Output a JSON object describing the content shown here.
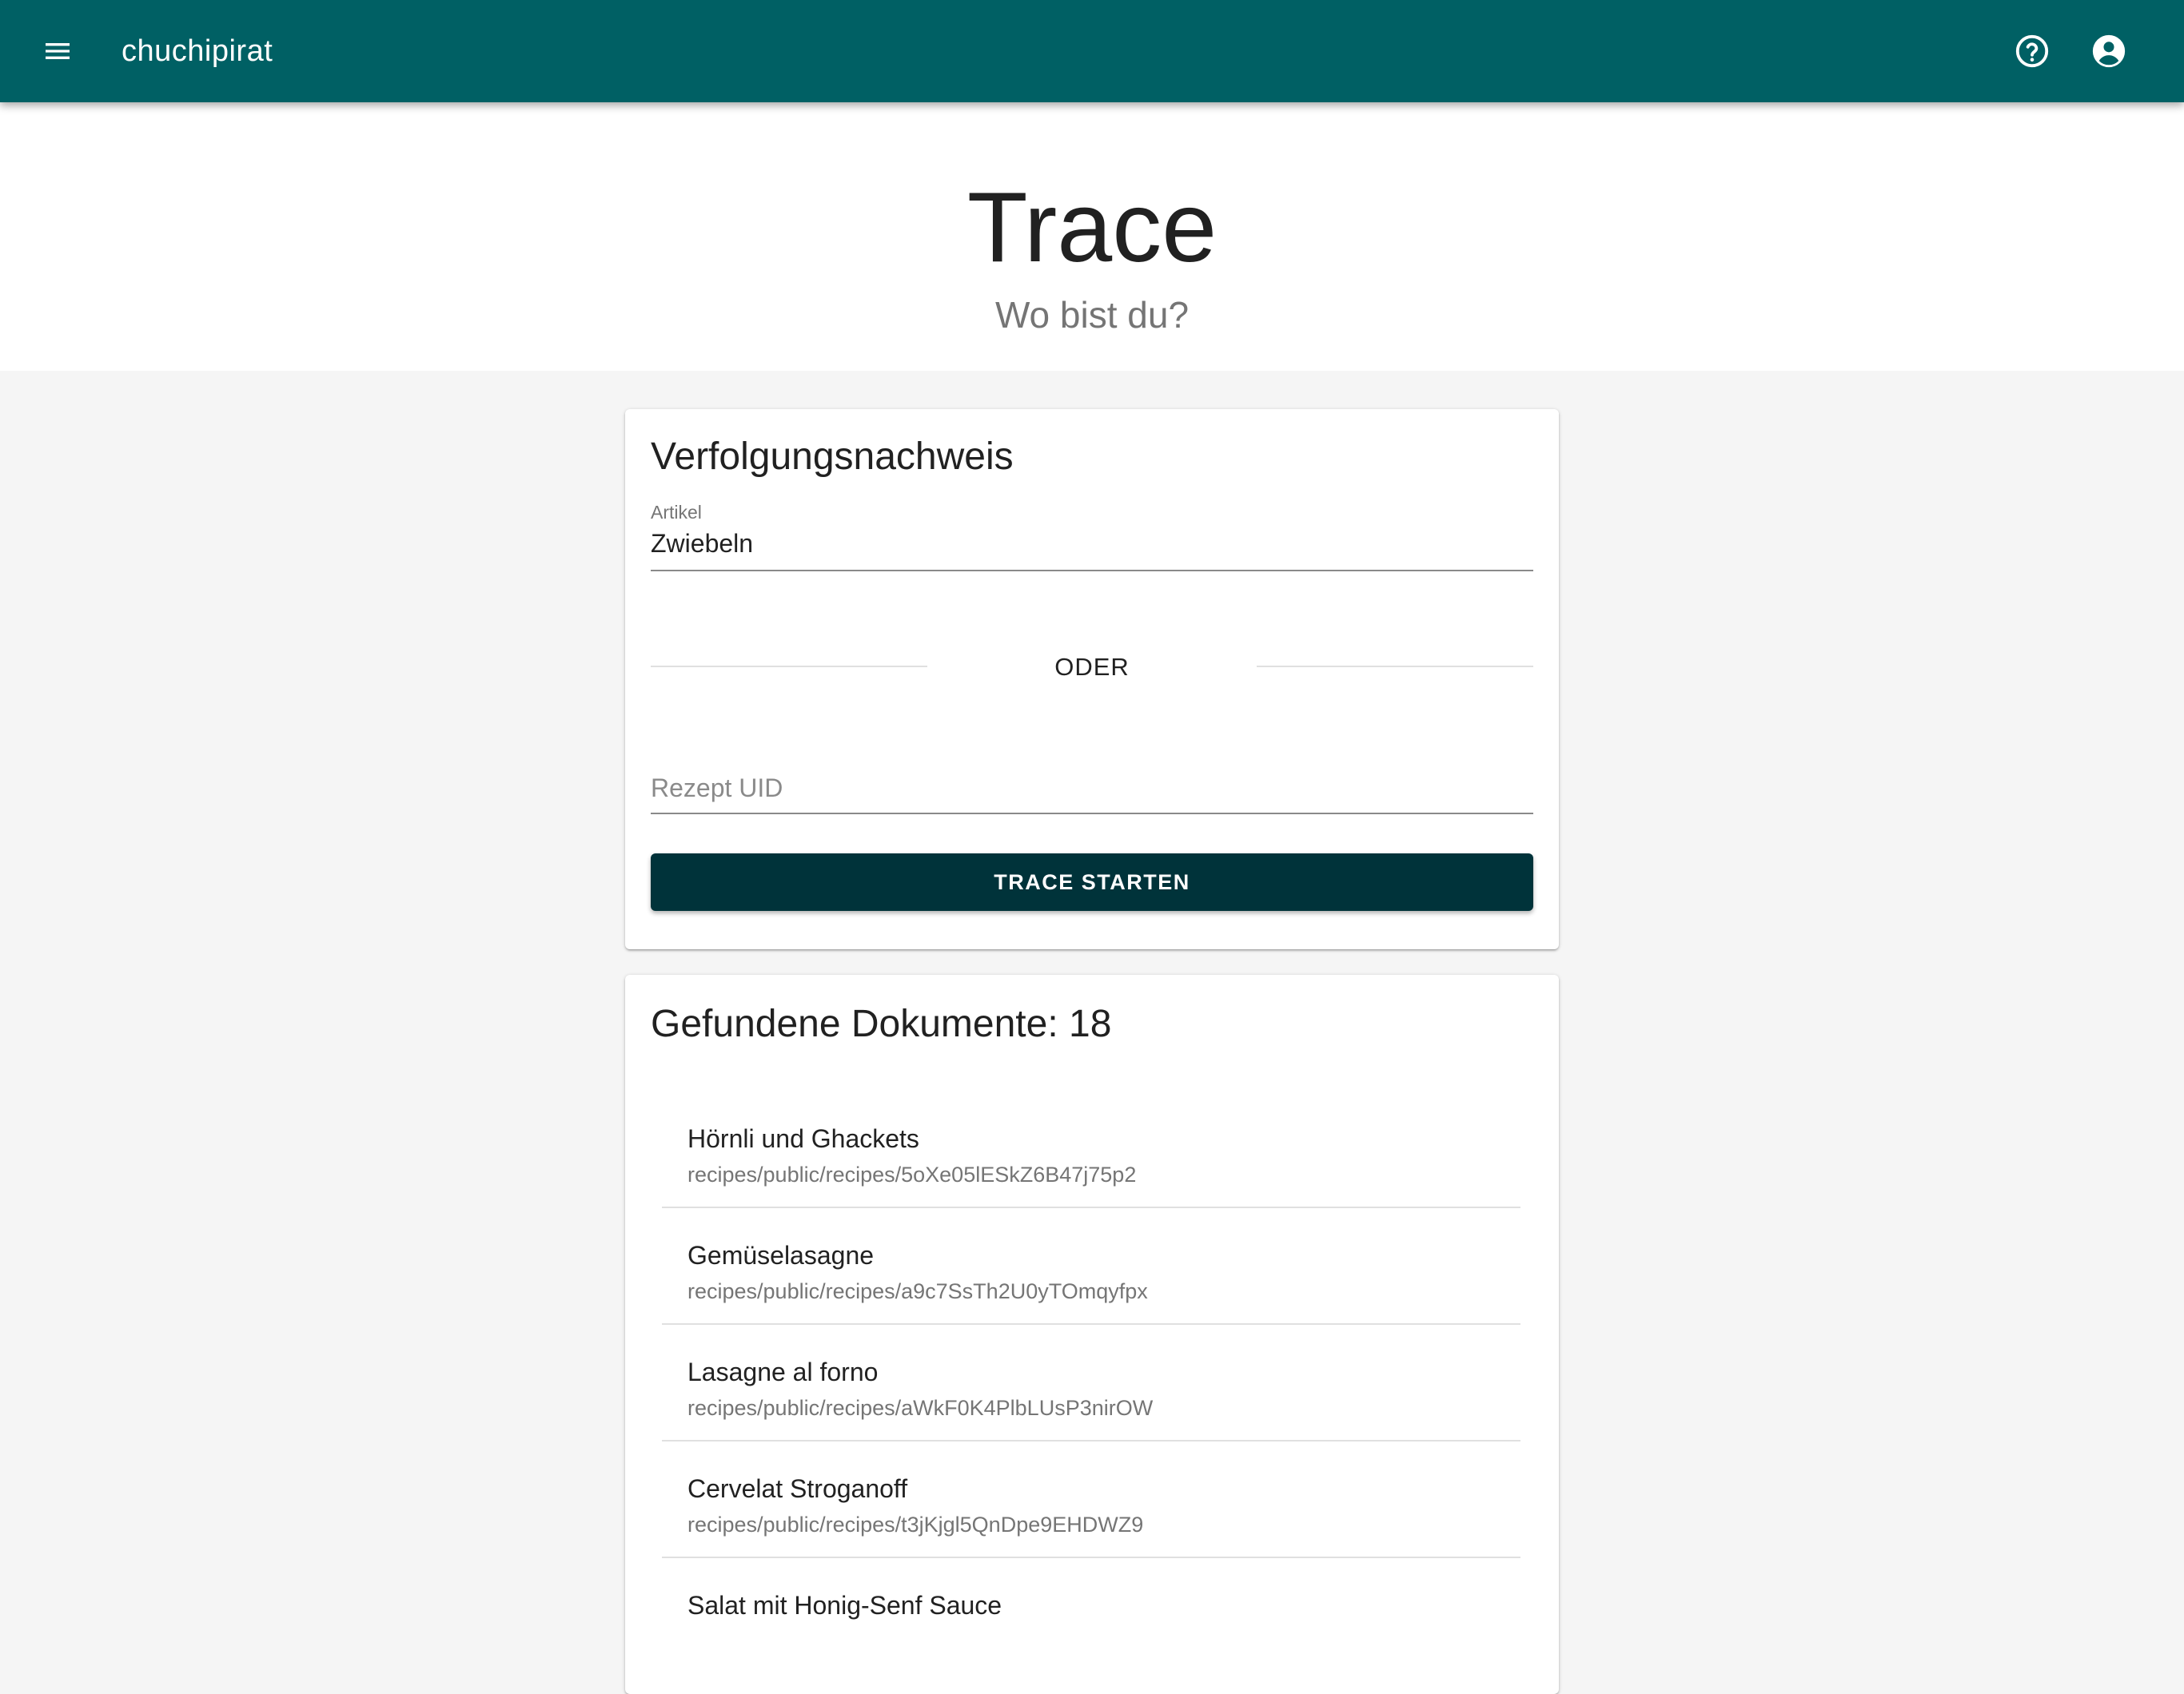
{
  "appbar": {
    "title": "chuchipirat",
    "menu_icon": "menu-icon",
    "help_icon": "help-circle-icon",
    "account_icon": "account-circle-icon",
    "color": "#006064"
  },
  "hero": {
    "title": "Trace",
    "subtitle": "Wo bist du?"
  },
  "search_card": {
    "title": "Verfolgungsnachweis",
    "article_label": "Artikel",
    "article_value": "Zwiebeln",
    "or_label": "ODER",
    "uid_placeholder": "Rezept UID",
    "uid_value": "",
    "start_button_label": "TRACE STARTEN",
    "button_color": "#00333a"
  },
  "results_card": {
    "title": "Gefundene Dokumente: 18",
    "documents": [
      {
        "name": "Hörnli und Ghackets",
        "path": "recipes/public/recipes/5oXe05lESkZ6B47j75p2"
      },
      {
        "name": "Gemüselasagne",
        "path": "recipes/public/recipes/a9c7SsTh2U0yTOmqyfpx"
      },
      {
        "name": "Lasagne al forno",
        "path": "recipes/public/recipes/aWkF0K4PlbLUsP3nirOW"
      },
      {
        "name": "Cervelat Stroganoff",
        "path": "recipes/public/recipes/t3jKjgl5QnDpe9EHDWZ9"
      },
      {
        "name": "Salat mit Honig-Senf Sauce",
        "path": ""
      }
    ]
  }
}
